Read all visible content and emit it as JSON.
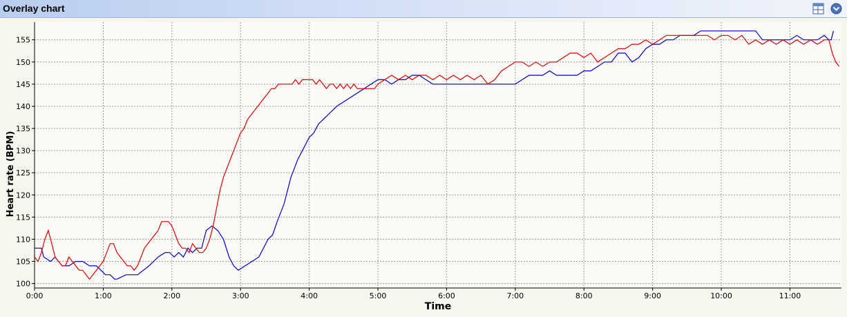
{
  "window": {
    "title": "Overlay chart"
  },
  "toolbar": {
    "layout_icon": "layout-icon",
    "menu_icon": "chevron-down-circle-icon"
  },
  "colors": {
    "series_blue": "#0000cc",
    "series_red": "#e00000",
    "grid": "#9a9a9a",
    "plot_bg": "#fbfaf6"
  },
  "chart_data": {
    "type": "line",
    "xlabel": "Time",
    "ylabel": "Heart rate (BPM)",
    "xlim": [
      0,
      705
    ],
    "ylim": [
      99,
      159
    ],
    "x_ticks": [
      0,
      60,
      120,
      180,
      240,
      300,
      360,
      420,
      480,
      540,
      600,
      660
    ],
    "x_tick_labels": [
      "0:00",
      "1:00",
      "2:00",
      "3:00",
      "4:00",
      "5:00",
      "6:00",
      "7:00",
      "8:00",
      "9:00",
      "10:00",
      "11:00"
    ],
    "y_ticks": [
      100,
      105,
      110,
      115,
      120,
      125,
      130,
      135,
      140,
      145,
      150,
      155
    ],
    "y_tick_labels": [
      "100",
      "105",
      "110",
      "115",
      "120",
      "125",
      "130",
      "135",
      "140",
      "145",
      "150",
      "155"
    ],
    "grid": true,
    "x_unit": "seconds",
    "series": [
      {
        "color": "#0000cc",
        "x": [
          0,
          6,
          8,
          14,
          18,
          24,
          30,
          36,
          42,
          48,
          54,
          58,
          62,
          66,
          70,
          72,
          80,
          90,
          100,
          104,
          108,
          114,
          118,
          122,
          126,
          130,
          134,
          138,
          142,
          146,
          150,
          155,
          160,
          165,
          170,
          174,
          178,
          184,
          190,
          196,
          200,
          204,
          208,
          212,
          218,
          224,
          230,
          236,
          240,
          244,
          248,
          252,
          256,
          260,
          264,
          270,
          276,
          282,
          288,
          294,
          300,
          306,
          312,
          318,
          324,
          330,
          336,
          342,
          348,
          354,
          360,
          366,
          372,
          378,
          384,
          390,
          396,
          402,
          408,
          414,
          420,
          426,
          432,
          438,
          444,
          450,
          456,
          462,
          468,
          474,
          480,
          486,
          492,
          498,
          504,
          510,
          516,
          522,
          528,
          534,
          540,
          546,
          552,
          558,
          564,
          570,
          576,
          582,
          588,
          594,
          600,
          606,
          612,
          618,
          624,
          630,
          636,
          642,
          648,
          654,
          660,
          666,
          672,
          678,
          684,
          690,
          694,
          696,
          698
        ],
        "y": [
          108,
          108,
          106,
          105,
          106,
          104,
          104,
          105,
          105,
          104,
          104,
          103,
          102,
          102,
          101,
          101,
          102,
          102,
          104,
          105,
          106,
          107,
          107,
          106,
          107,
          106,
          108,
          107,
          108,
          108,
          112,
          113,
          112,
          110,
          106,
          104,
          103,
          104,
          105,
          106,
          108,
          110,
          111,
          114,
          118,
          124,
          128,
          131,
          133,
          134,
          136,
          137,
          138,
          139,
          140,
          141,
          142,
          143,
          144,
          145,
          146,
          146,
          145,
          146,
          146,
          147,
          147,
          146,
          145,
          145,
          145,
          145,
          145,
          145,
          145,
          145,
          145,
          145,
          145,
          145,
          145,
          146,
          147,
          147,
          147,
          148,
          147,
          147,
          147,
          147,
          148,
          148,
          149,
          150,
          150,
          152,
          152,
          150,
          151,
          153,
          154,
          154,
          155,
          155,
          156,
          156,
          156,
          157,
          157,
          157,
          157,
          157,
          157,
          157,
          157,
          157,
          155,
          155,
          155,
          155,
          155,
          156,
          155,
          155,
          155,
          156,
          155,
          155,
          157
        ]
      },
      {
        "color": "#e00000",
        "x": [
          0,
          3,
          6,
          9,
          12,
          15,
          18,
          21,
          24,
          27,
          30,
          33,
          36,
          39,
          42,
          45,
          48,
          51,
          54,
          57,
          60,
          63,
          66,
          69,
          72,
          75,
          78,
          81,
          84,
          87,
          90,
          93,
          96,
          99,
          102,
          105,
          108,
          111,
          114,
          117,
          120,
          123,
          126,
          129,
          132,
          135,
          138,
          141,
          144,
          147,
          150,
          153,
          156,
          159,
          162,
          165,
          168,
          171,
          174,
          177,
          180,
          183,
          186,
          189,
          192,
          195,
          198,
          201,
          204,
          207,
          210,
          213,
          216,
          219,
          222,
          225,
          228,
          231,
          234,
          237,
          240,
          243,
          246,
          249,
          252,
          255,
          258,
          261,
          264,
          267,
          270,
          273,
          276,
          279,
          282,
          285,
          288,
          291,
          294,
          297,
          300,
          306,
          312,
          318,
          324,
          330,
          336,
          342,
          348,
          354,
          360,
          366,
          372,
          378,
          384,
          390,
          396,
          402,
          408,
          414,
          420,
          426,
          432,
          438,
          444,
          450,
          456,
          462,
          468,
          474,
          480,
          486,
          492,
          498,
          504,
          510,
          516,
          522,
          528,
          534,
          540,
          546,
          552,
          558,
          564,
          570,
          576,
          582,
          588,
          594,
          600,
          606,
          612,
          618,
          624,
          630,
          636,
          642,
          648,
          654,
          660,
          666,
          672,
          678,
          684,
          690,
          694,
          697,
          700,
          703
        ],
        "y": [
          106,
          105,
          107,
          110,
          112,
          109,
          106,
          105,
          104,
          104,
          106,
          105,
          104,
          103,
          103,
          102,
          101,
          102,
          103,
          104,
          105,
          107,
          109,
          109,
          107,
          106,
          105,
          104,
          104,
          103,
          104,
          106,
          108,
          109,
          110,
          111,
          112,
          114,
          114,
          114,
          113,
          111,
          109,
          108,
          108,
          107,
          109,
          108,
          107,
          107,
          108,
          110,
          113,
          117,
          121,
          124,
          126,
          128,
          130,
          132,
          134,
          135,
          137,
          138,
          139,
          140,
          141,
          142,
          143,
          144,
          144,
          145,
          145,
          145,
          145,
          145,
          146,
          145,
          146,
          146,
          146,
          146,
          145,
          146,
          145,
          144,
          145,
          145,
          144,
          145,
          144,
          145,
          144,
          145,
          144,
          144,
          144,
          144,
          144,
          144,
          145,
          146,
          147,
          146,
          147,
          146,
          147,
          147,
          146,
          147,
          146,
          147,
          146,
          147,
          146,
          147,
          145,
          146,
          148,
          149,
          150,
          150,
          149,
          150,
          149,
          150,
          150,
          151,
          152,
          152,
          151,
          152,
          150,
          151,
          152,
          153,
          153,
          154,
          154,
          155,
          154,
          155,
          156,
          156,
          156,
          156,
          156,
          156,
          156,
          155,
          156,
          156,
          155,
          156,
          154,
          155,
          154,
          155,
          154,
          155,
          154,
          155,
          154,
          155,
          154,
          155,
          155,
          152,
          150,
          149
        ]
      }
    ]
  }
}
